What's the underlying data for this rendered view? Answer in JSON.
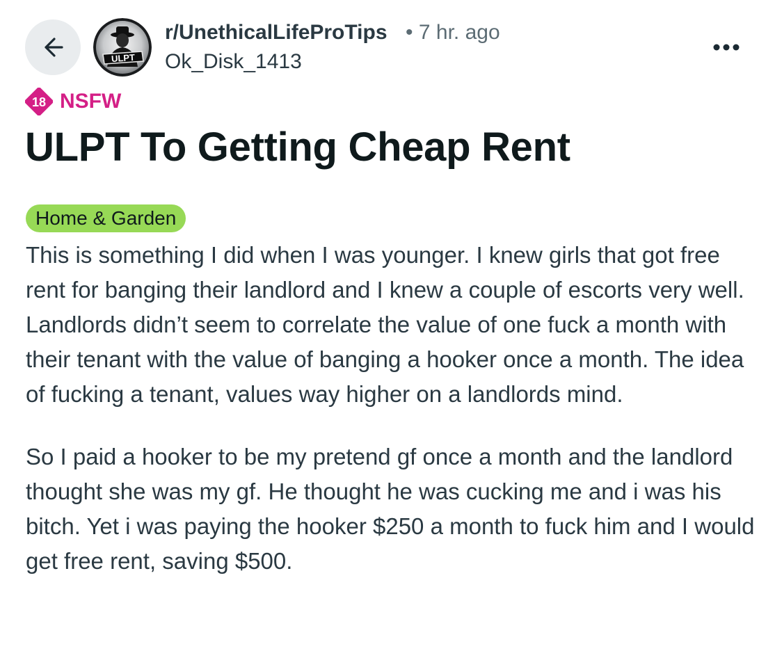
{
  "header": {
    "subreddit": "r/UnethicalLifeProTips",
    "separator": "•",
    "time_ago": "7 hr. ago",
    "author": "Ok_Disk_1413",
    "avatar_text": "ULPT",
    "back_icon": "arrow-left-icon",
    "more_icon": "ellipsis-horizontal-icon"
  },
  "nsfw": {
    "badge_number": "18",
    "label": "NSFW",
    "color": "#d41f86"
  },
  "post": {
    "title": "ULPT To Getting Cheap Rent",
    "flair": "Home & Garden",
    "flair_color": "#97d956",
    "paragraphs": [
      "This is something I did when I was younger. I knew girls that got free rent for banging their landlord and I knew a couple of escorts very well. Landlords didn’t seem to correlate the value of one fuck a month with their tenant with the value of banging a hooker once a month. The idea of fucking a tenant, values way higher on a landlords mind.",
      "So I paid a hooker to be my pretend gf once a month and the landlord thought she was my gf. He thought he was cucking me and i was his bitch. Yet i was paying the hooker $250 a month to fuck him and I would get free rent, saving $500."
    ]
  }
}
